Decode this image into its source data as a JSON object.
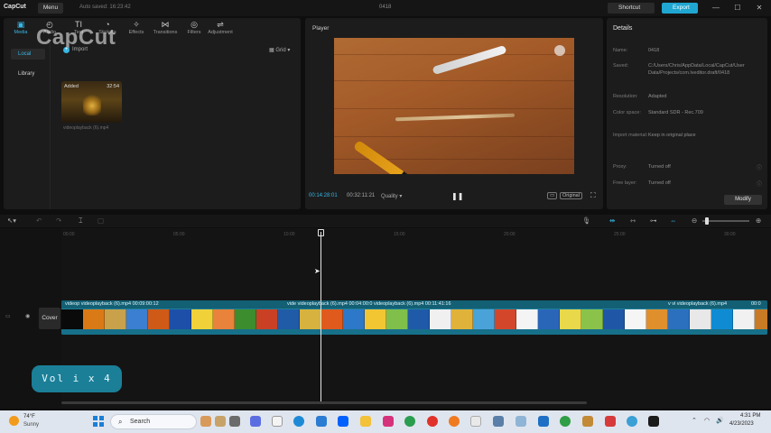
{
  "titlebar": {
    "app_name": "CapCut",
    "menu_label": "Menu",
    "autosave": "Auto saved: 16:23:42",
    "project_title": "0418",
    "shortcut_label": "Shortcut",
    "export_label": "Export",
    "minimize": "—",
    "maximize": "☐",
    "close": "✕"
  },
  "media_panel": {
    "watermark": "CapCut",
    "tabs": [
      {
        "label": "Media",
        "icon": "media-icon",
        "glyph": "▣"
      },
      {
        "label": "Audio",
        "icon": "audio-icon",
        "glyph": "◴"
      },
      {
        "label": "Text",
        "icon": "text-icon",
        "glyph": "TI"
      },
      {
        "label": "Stickers",
        "icon": "sticker-icon",
        "glyph": "◔"
      },
      {
        "label": "Effects",
        "icon": "effects-icon",
        "glyph": "✧"
      },
      {
        "label": "Transitions",
        "icon": "transitions-icon",
        "glyph": "⋈"
      },
      {
        "label": "Filters",
        "icon": "filters-icon",
        "glyph": "◎"
      },
      {
        "label": "Adjustment",
        "icon": "adjustment-icon",
        "glyph": "⇌"
      }
    ],
    "side_local": "Local",
    "side_library": "Library",
    "import_label": "Import",
    "grid_label": "Grid",
    "thumb_added": "Added",
    "thumb_duration": "32:54",
    "thumb_name": "videoplayback (6).mp4"
  },
  "player": {
    "title": "Player",
    "time_current": "00:14:28:01",
    "time_total": "00:32:11:21",
    "quality": "Quality",
    "ratio": "Ratio",
    "original": "Original"
  },
  "details": {
    "title": "Details",
    "rows": [
      {
        "label": "Name:",
        "value": "0418"
      },
      {
        "label": "Saved:",
        "value": "C:/Users/Chris/AppData/Local/CapCut/User Data/Projects/com.lveditor.draft/0418"
      },
      {
        "label": "Resolution:",
        "value": "Adapted"
      },
      {
        "label": "Color space:",
        "value": "Standard SDR - Rec.709"
      },
      {
        "label": "Import material:",
        "value": "Keep in original place"
      },
      {
        "label": "Proxy:",
        "value": "Turned off"
      },
      {
        "label": "Free layer:",
        "value": "Turned off"
      }
    ],
    "modify_label": "Modify"
  },
  "timeline": {
    "ruler_ticks": [
      "00:00",
      "05:00",
      "10:00",
      "15:00",
      "20:00",
      "25:00",
      "30:00"
    ],
    "cover_label": "Cover",
    "clip_labels": [
      "videop  videoplayback (6).mp4   00:09:00:12",
      "vide  videoplayback (6).mp4   00:04:00:0  videoplayback (6).mp4   00:11:41:16",
      "v  vi  videoplayback (6).mp4",
      "00:0"
    ],
    "frame_colors": [
      "#0a0a0a",
      "#d97a17",
      "#c8a14a",
      "#3a7fd1",
      "#cf5a18",
      "#1d4fa8",
      "#f0d13a",
      "#e9823a",
      "#3b8d2e",
      "#c94024",
      "#1f5ba6",
      "#d8b23e",
      "#e05a1d",
      "#2d78c8",
      "#f2c533",
      "#7fbf4a",
      "#1e5aa8",
      "#f0f0f0",
      "#e1b23a",
      "#4aa3d8",
      "#d4462a",
      "#f4f4f4",
      "#2a66b8",
      "#e8d84a",
      "#8bc34a",
      "#1f57a6",
      "#f5f5f5",
      "#df8f2c",
      "#2b6fbf",
      "#e8e8e8",
      "#0f8bd4",
      "#f1f1f1",
      "#c97a24",
      "#5fa9d9",
      "#e0a030",
      "#f3f3f3"
    ],
    "volume_badge": "Vol i x 4"
  },
  "taskbar": {
    "temperature": "74°F",
    "condition": "Sunny",
    "search_label": "Search",
    "time": "4:31 PM",
    "date": "4/23/2023"
  }
}
